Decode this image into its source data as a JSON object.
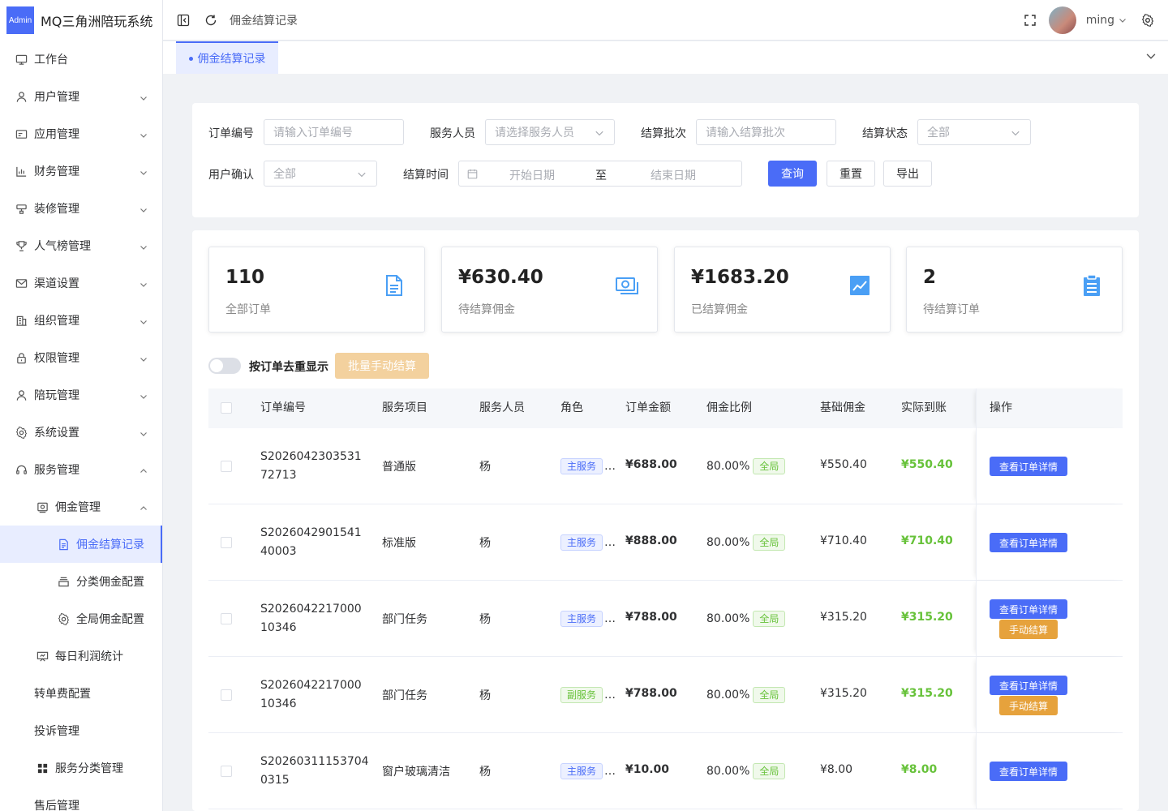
{
  "app": {
    "logo_badge": "Admin",
    "title": "MQ三角洲陪玩系统"
  },
  "sidebar": {
    "items": [
      {
        "label": "工作台",
        "icon": "monitor-icon"
      },
      {
        "label": "用户管理",
        "icon": "user-icon"
      },
      {
        "label": "应用管理",
        "icon": "app-icon"
      },
      {
        "label": "财务管理",
        "icon": "chart-icon"
      },
      {
        "label": "装修管理",
        "icon": "decor-icon"
      },
      {
        "label": "人气榜管理",
        "icon": "trophy-icon"
      },
      {
        "label": "渠道设置",
        "icon": "mail-icon"
      },
      {
        "label": "组织管理",
        "icon": "building-icon"
      },
      {
        "label": "权限管理",
        "icon": "lock-icon"
      },
      {
        "label": "陪玩管理",
        "icon": "user-icon"
      },
      {
        "label": "系统设置",
        "icon": "gear-icon"
      },
      {
        "label": "服务管理",
        "icon": "headset-icon"
      },
      {
        "label": "佣金管理",
        "icon": "wallet-icon"
      },
      {
        "label": "佣金结算记录",
        "icon": "document-icon"
      },
      {
        "label": "分类佣金配置",
        "icon": "layers-icon"
      },
      {
        "label": "全局佣金配置",
        "icon": "gear-icon"
      },
      {
        "label": "每日利润统计",
        "icon": "presentation-icon"
      },
      {
        "label": "转单费配置"
      },
      {
        "label": "投诉管理"
      },
      {
        "label": "服务分类管理",
        "icon": "grid-icon"
      },
      {
        "label": "售后管理"
      }
    ]
  },
  "header": {
    "breadcrumb": "佣金结算记录",
    "username": "ming"
  },
  "tabs": [
    {
      "label": "佣金结算记录"
    }
  ],
  "filters": {
    "order_no": {
      "label": "订单编号",
      "placeholder": "请输入订单编号"
    },
    "staff": {
      "label": "服务人员",
      "placeholder": "请选择服务人员"
    },
    "batch": {
      "label": "结算批次",
      "placeholder": "请输入结算批次"
    },
    "status": {
      "label": "结算状态",
      "value": "全部"
    },
    "user_confirm": {
      "label": "用户确认",
      "value": "全部"
    },
    "settle_time": {
      "label": "结算时间",
      "start": "开始日期",
      "sep": "至",
      "end": "结束日期"
    },
    "buttons": {
      "query": "查询",
      "reset": "重置",
      "export": "导出"
    }
  },
  "stats": [
    {
      "value": "110",
      "label": "全部订单",
      "icon": "document-icon"
    },
    {
      "value": "¥630.40",
      "label": "待结算佣金",
      "icon": "money-icon"
    },
    {
      "value": "¥1683.20",
      "label": "已结算佣金",
      "icon": "trend-icon"
    },
    {
      "value": "2",
      "label": "待结算订单",
      "icon": "clipboard-icon"
    }
  ],
  "toolbar": {
    "switch_label": "按订单去重显示",
    "switch_on": false,
    "batch_button": "批量手动结算"
  },
  "table": {
    "columns": [
      "订单编号",
      "服务项目",
      "服务人员",
      "角色",
      "订单金额",
      "佣金比例",
      "基础佣金",
      "实际到账",
      "操作"
    ],
    "rows": [
      {
        "order_no_1": "S2026042303531",
        "order_no_2": "72713",
        "item": "普通版",
        "staff": "杨",
        "role": "主服务",
        "role_type": "main",
        "role_more": "…",
        "amount": "¥688.00",
        "ratio": "80.00%",
        "scope": "全局",
        "base": "¥550.40",
        "actual": "¥550.40",
        "actions": [
          "查看订单详情"
        ]
      },
      {
        "order_no_1": "S2026042901541",
        "order_no_2": "40003",
        "item": "标准版",
        "staff": "杨",
        "role": "主服务",
        "role_type": "main",
        "role_more": "…",
        "amount": "¥888.00",
        "ratio": "80.00%",
        "scope": "全局",
        "base": "¥710.40",
        "actual": "¥710.40",
        "actions": [
          "查看订单详情"
        ]
      },
      {
        "order_no_1": "S2026042217000",
        "order_no_2": "10346",
        "item": "部门任务",
        "staff": "杨",
        "role": "主服务",
        "role_type": "main",
        "role_more": "…",
        "amount": "¥788.00",
        "ratio": "80.00%",
        "scope": "全局",
        "base": "¥315.20",
        "actual": "¥315.20",
        "actions": [
          "查看订单详情",
          "手动结算"
        ]
      },
      {
        "order_no_1": "S2026042217000",
        "order_no_2": "10346",
        "item": "部门任务",
        "staff": "杨",
        "role": "副服务",
        "role_type": "sub",
        "role_more": "…",
        "amount": "¥788.00",
        "ratio": "80.00%",
        "scope": "全局",
        "base": "¥315.20",
        "actual": "¥315.20",
        "actions": [
          "查看订单详情",
          "手动结算"
        ]
      },
      {
        "order_no_1": "S20260311153704",
        "order_no_2": "0315",
        "item": "窗户玻璃清洁",
        "staff": "杨",
        "role": "主服务",
        "role_type": "main",
        "role_more": "…",
        "amount": "¥10.00",
        "ratio": "80.00%",
        "scope": "全局",
        "base": "¥8.00",
        "actual": "¥8.00",
        "actions": [
          "查看订单详情"
        ]
      }
    ]
  },
  "colors": {
    "primary": "#4a6cf7",
    "success": "#67c23a",
    "warning": "#e6a23c",
    "batch_disabled": "#f3d19e"
  }
}
